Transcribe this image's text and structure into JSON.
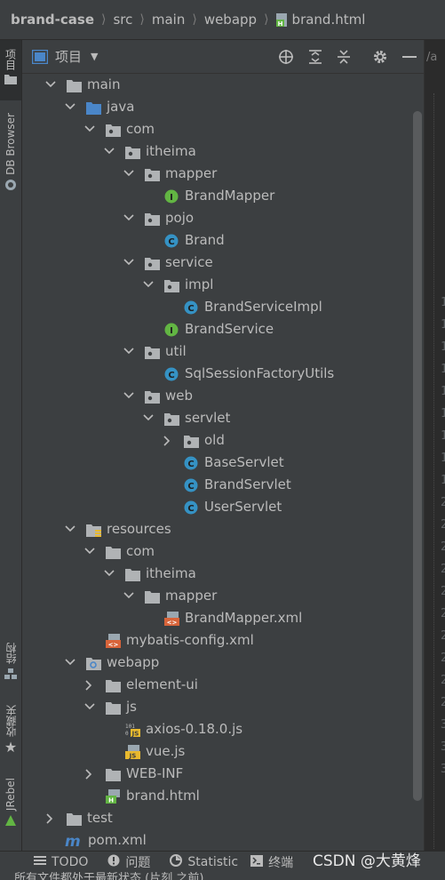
{
  "breadcrumb": {
    "items": [
      "brand-case",
      "src",
      "main",
      "webapp",
      "brand.html"
    ]
  },
  "left_strip": {
    "tabs": [
      "项目",
      "DB Browser",
      "结构",
      "收藏夹",
      "JRebel"
    ]
  },
  "panel": {
    "title": "项目",
    "icons": [
      "locate-icon",
      "expand-all-icon",
      "collapse-all-icon",
      "settings-icon",
      "minimize-icon"
    ]
  },
  "tree": [
    {
      "label": "main",
      "depth": 0,
      "icon": "folder",
      "expanded": true
    },
    {
      "label": "java",
      "depth": 1,
      "icon": "source-folder",
      "expanded": true
    },
    {
      "label": "com",
      "depth": 2,
      "icon": "package",
      "expanded": true
    },
    {
      "label": "itheima",
      "depth": 3,
      "icon": "package",
      "expanded": true
    },
    {
      "label": "mapper",
      "depth": 4,
      "icon": "package",
      "expanded": true
    },
    {
      "label": "BrandMapper",
      "depth": 5,
      "icon": "interface"
    },
    {
      "label": "pojo",
      "depth": 4,
      "icon": "package",
      "expanded": true
    },
    {
      "label": "Brand",
      "depth": 5,
      "icon": "class"
    },
    {
      "label": "service",
      "depth": 4,
      "icon": "package",
      "expanded": true
    },
    {
      "label": "impl",
      "depth": 5,
      "icon": "package",
      "expanded": true
    },
    {
      "label": "BrandServiceImpl",
      "depth": 6,
      "icon": "class"
    },
    {
      "label": "BrandService",
      "depth": 5,
      "icon": "interface"
    },
    {
      "label": "util",
      "depth": 4,
      "icon": "package",
      "expanded": true
    },
    {
      "label": "SqlSessionFactoryUtils",
      "depth": 5,
      "icon": "class"
    },
    {
      "label": "web",
      "depth": 4,
      "icon": "package",
      "expanded": true
    },
    {
      "label": "servlet",
      "depth": 5,
      "icon": "package",
      "expanded": true
    },
    {
      "label": "old",
      "depth": 6,
      "icon": "package",
      "expanded": false
    },
    {
      "label": "BaseServlet",
      "depth": 6,
      "icon": "class"
    },
    {
      "label": "BrandServlet",
      "depth": 6,
      "icon": "class"
    },
    {
      "label": "UserServlet",
      "depth": 6,
      "icon": "class"
    },
    {
      "label": "resources",
      "depth": 1,
      "icon": "resources-folder",
      "expanded": true
    },
    {
      "label": "com",
      "depth": 2,
      "icon": "folder",
      "expanded": true
    },
    {
      "label": "itheima",
      "depth": 3,
      "icon": "folder",
      "expanded": true
    },
    {
      "label": "mapper",
      "depth": 4,
      "icon": "folder",
      "expanded": true
    },
    {
      "label": "BrandMapper.xml",
      "depth": 5,
      "icon": "xml"
    },
    {
      "label": "mybatis-config.xml",
      "depth": 2,
      "icon": "xml"
    },
    {
      "label": "webapp",
      "depth": 1,
      "icon": "web-folder",
      "expanded": true
    },
    {
      "label": "element-ui",
      "depth": 2,
      "icon": "folder",
      "expanded": false
    },
    {
      "label": "js",
      "depth": 2,
      "icon": "folder",
      "expanded": true
    },
    {
      "label": "axios-0.18.0.js",
      "depth": 3,
      "icon": "js-min"
    },
    {
      "label": "vue.js",
      "depth": 3,
      "icon": "js"
    },
    {
      "label": "WEB-INF",
      "depth": 2,
      "icon": "folder",
      "expanded": false
    },
    {
      "label": "brand.html",
      "depth": 2,
      "icon": "html"
    },
    {
      "label": "test",
      "depth": 0,
      "icon": "folder",
      "expanded": false
    },
    {
      "label": "pom.xml",
      "depth": -1,
      "icon": "maven"
    }
  ],
  "editor_strip": {
    "tab_fragment": "/a",
    "line_numbers": [
      "1",
      "1",
      "1",
      "1",
      "1",
      "1",
      "1",
      "1",
      "1",
      "2",
      "2",
      "2",
      "2",
      "2",
      "2",
      "2",
      "2",
      "2",
      "2",
      "3",
      "3",
      "3"
    ]
  },
  "bottom_tools": [
    {
      "label": "TODO",
      "icon": "list-icon"
    },
    {
      "label": "问题",
      "icon": "problems-icon"
    },
    {
      "label": "Statistic",
      "icon": "statistic-icon"
    },
    {
      "label": "终端",
      "icon": "terminal-icon"
    }
  ],
  "watermark": "CSDN @大黄烽",
  "status": "所有文件都处于最新状态 (片刻 之前)",
  "colors": {
    "background": "#3c3f41",
    "folder": "#b0b3b5",
    "source_folder": "#4a86c8",
    "class": "#3592c4",
    "interface": "#62b543",
    "xml": "#d8643a",
    "js": "#e8b92e"
  }
}
